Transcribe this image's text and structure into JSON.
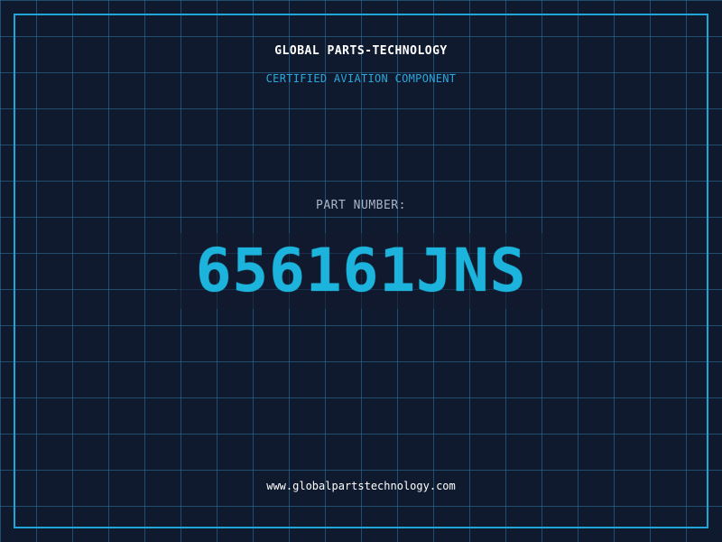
{
  "header": {
    "brand": "GLOBAL PARTS-TECHNOLOGY",
    "subtitle": "CERTIFIED AVIATION COMPONENT"
  },
  "part": {
    "label": "PART NUMBER:",
    "number": "656161JNS"
  },
  "footer": {
    "website": "www.globalpartstechnology.com"
  },
  "colors": {
    "background": "#101a2e",
    "grid": "#388cbe",
    "frame": "#1fa6d6",
    "accent": "#1cb4dc",
    "label": "#a8b4c8",
    "text": "#ffffff"
  }
}
